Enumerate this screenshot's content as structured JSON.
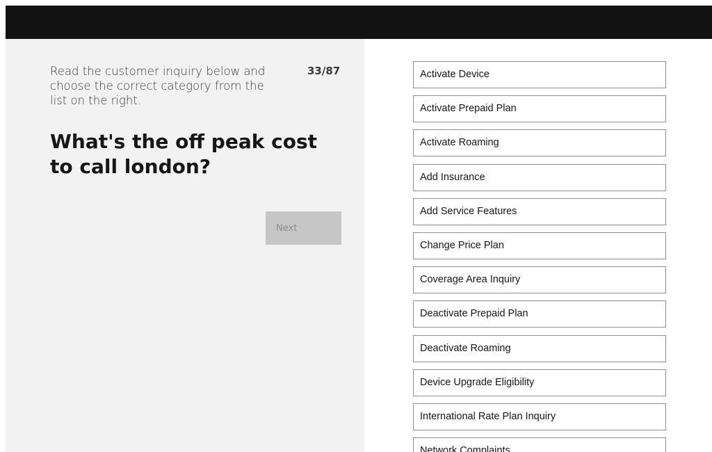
{
  "task": {
    "instructions": "Read the customer inquiry below and choose the correct category from the list on the right.",
    "progress": "33/87",
    "question": "What's the off peak cost to call london?",
    "next_label": "Next"
  },
  "categories": [
    "Activate Device",
    "Activate Prepaid Plan",
    "Activate Roaming",
    "Add Insurance",
    "Add Service Features",
    "Change Price Plan",
    "Coverage Area Inquiry",
    "Deactivate Prepaid Plan",
    "Deactivate Roaming",
    "Device Upgrade Eligibility",
    "International Rate Plan Inquiry",
    "Network Complaints"
  ],
  "colors": {
    "top_bar": "#121212",
    "left_panel": "#f2f2f2",
    "button_disabled_bg": "#c6c6c6",
    "button_disabled_text": "#8d8d8d",
    "item_border": "#8d8d8d"
  }
}
